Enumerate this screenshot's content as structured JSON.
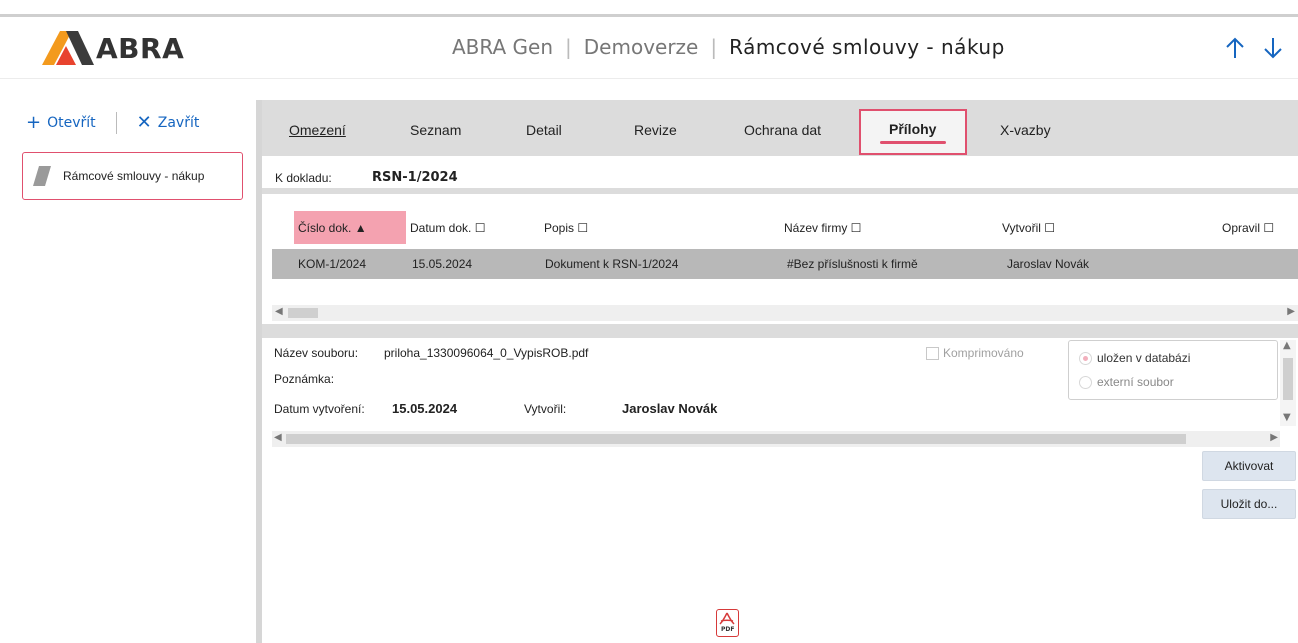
{
  "brand": {
    "name": "ABRA",
    "accent": "#e0506e",
    "link_color": "#1565c0"
  },
  "header": {
    "app": "ABRA Gen",
    "edition": "Demoverze",
    "title": "Rámcové smlouvy - nákup",
    "up_icon": "arrow-up-icon",
    "down_icon": "arrow-down-icon"
  },
  "sidebar": {
    "open_label": "Otevřít",
    "close_label": "Zavřít",
    "nav_item": "Rámcové smlouvy - nákup"
  },
  "tabs": [
    {
      "label": "Omezení",
      "active": false
    },
    {
      "label": "Seznam",
      "active": false
    },
    {
      "label": "Detail",
      "active": false
    },
    {
      "label": "Revize",
      "active": false
    },
    {
      "label": "Ochrana dat",
      "active": false
    },
    {
      "label": "Přílohy",
      "active": true
    },
    {
      "label": "X-vazby",
      "active": false
    }
  ],
  "document": {
    "label": "K dokladu:",
    "value": "RSN-1/2024"
  },
  "grid": {
    "columns": [
      "Číslo dok. ▲",
      "Datum dok. ☐",
      "Popis ☐",
      "Název firmy ☐",
      "Vytvořil ☐",
      "Opravil ☐"
    ],
    "rows": [
      {
        "cislo": "KOM-1/2024",
        "datum": "15.05.2024",
        "popis": "Dokument k RSN-1/2024",
        "firma": "#Bez příslušnosti k firmě",
        "vytvoril": "Jaroslav Novák",
        "opravil": ""
      }
    ]
  },
  "detail": {
    "file_label": "Název souboru:",
    "file_value": "priloha_1330096064_0_VypisROB.pdf",
    "note_label": "Poznámka:",
    "created_label": "Datum vytvoření:",
    "created_value": "15.05.2024",
    "author_label": "Vytvořil:",
    "author_value": "Jaroslav Novák",
    "compressed_label": "Komprimováno",
    "storage_db": "uložen v databázi",
    "storage_ext": "externí soubor"
  },
  "actions": {
    "activate": "Aktivovat",
    "save_to": "Uložit do..."
  },
  "preview": {
    "icon": "pdf-icon",
    "label": "PDF"
  }
}
